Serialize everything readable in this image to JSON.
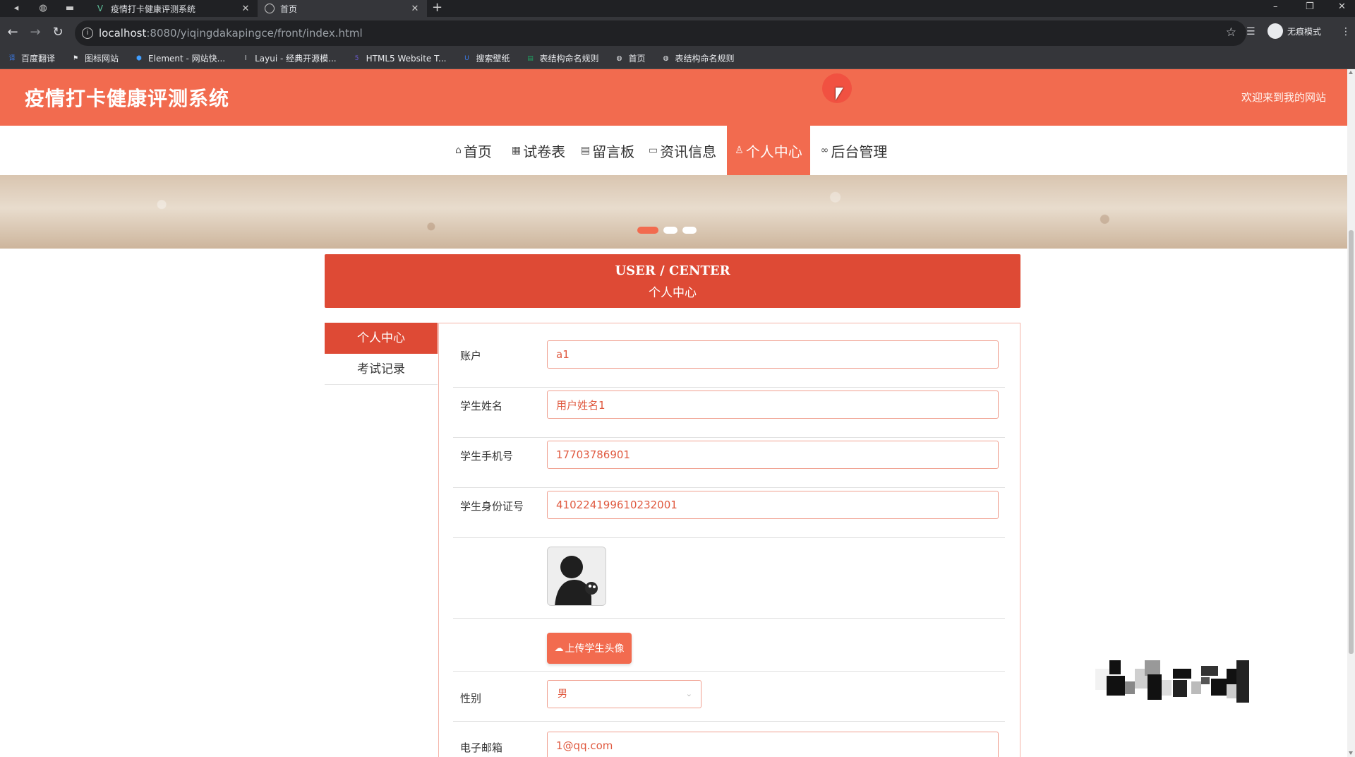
{
  "browser": {
    "tabs": [
      {
        "title": "疫情打卡健康评测系统",
        "active": false
      },
      {
        "title": "首页",
        "active": true
      }
    ],
    "url_host": "localhost",
    "url_rest": ":8080/yiqingdakapingce/front/index.html",
    "profile_label": "无痕模式",
    "bookmarks": [
      {
        "label": "百度翻译",
        "icon": "translate-icon",
        "color": "#3b7be8"
      },
      {
        "label": "图标网站",
        "icon": "flag-icon",
        "color": "#e8eaed"
      },
      {
        "label": "Element - 网站快...",
        "icon": "element-icon",
        "color": "#409eff"
      },
      {
        "label": "Layui - 经典开源模...",
        "icon": "layui-icon",
        "color": "#e8eaed"
      },
      {
        "label": "HTML5 Website T...",
        "icon": "html5-icon",
        "color": "#6a5acd"
      },
      {
        "label": "搜索壁纸",
        "icon": "wallpaper-icon",
        "color": "#3b7be8"
      },
      {
        "label": "表结构命名规则",
        "icon": "sheet-icon",
        "color": "#1ea362"
      },
      {
        "label": "首页",
        "icon": "globe-icon",
        "color": "#e8eaed"
      },
      {
        "label": "表结构命名规则",
        "icon": "globe-icon",
        "color": "#e8eaed"
      }
    ]
  },
  "site": {
    "title": "疫情打卡健康评测系统",
    "welcome": "欢迎来到我的网站",
    "accent": "#f26b4f",
    "header_accent": "#de4a35",
    "nav": [
      {
        "label": "首页",
        "icon": "home-icon",
        "active": false
      },
      {
        "label": "试卷表",
        "icon": "grid-icon",
        "active": false
      },
      {
        "label": "留言板",
        "icon": "message-icon",
        "active": false
      },
      {
        "label": "资讯信息",
        "icon": "news-icon",
        "active": false
      },
      {
        "label": "个人中心",
        "icon": "user-icon",
        "active": true
      },
      {
        "label": "后台管理",
        "icon": "link-icon",
        "active": false
      }
    ]
  },
  "user_center": {
    "title_en": "USER / CENTER",
    "title_cn": "个人中心",
    "side_menu": [
      {
        "label": "个人中心",
        "active": true
      },
      {
        "label": "考试记录",
        "active": false
      }
    ],
    "form": {
      "account_label": "账户",
      "account_value": "a1",
      "name_label": "学生姓名",
      "name_value": "用户姓名1",
      "phone_label": "学生手机号",
      "phone_value": "17703786901",
      "idcard_label": "学生身份证号",
      "idcard_value": "410224199610232001",
      "upload_label": "上传学生头像",
      "gender_label": "性别",
      "gender_value": "男",
      "email_label": "电子邮箱",
      "email_value": "1@qq.com"
    }
  }
}
